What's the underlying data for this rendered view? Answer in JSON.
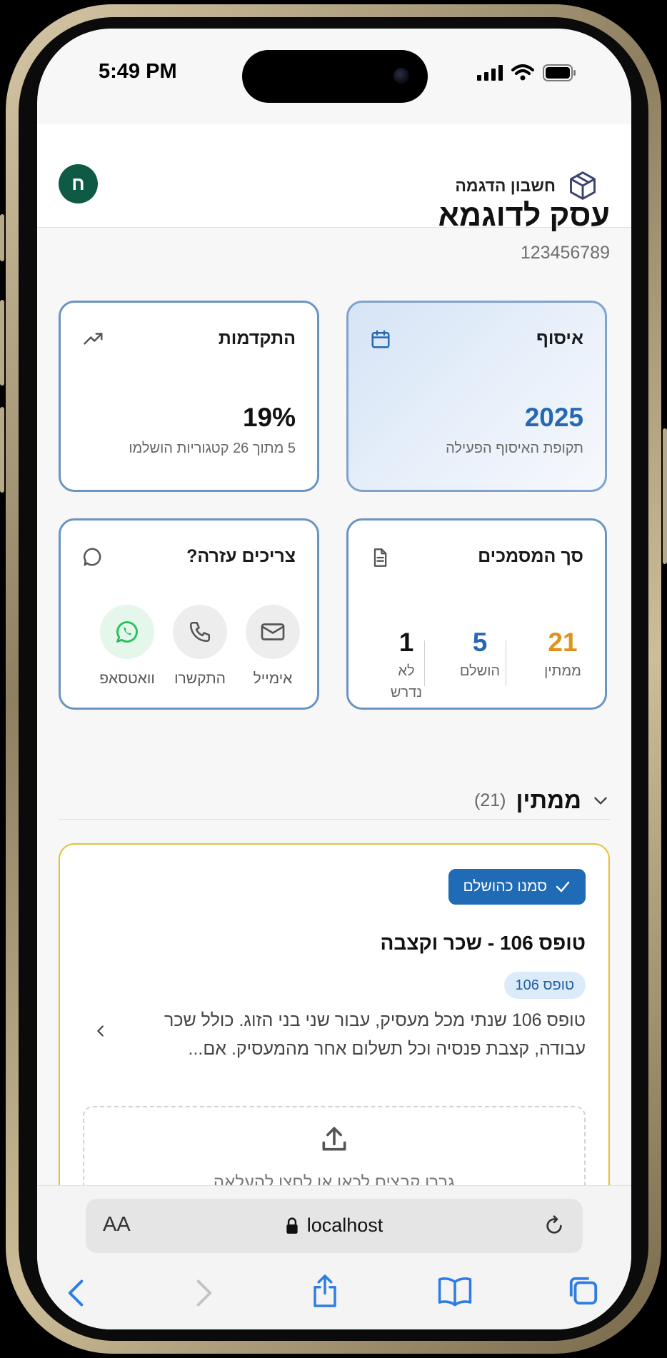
{
  "status": {
    "time": "5:49 PM"
  },
  "header": {
    "avatar_letter": "ח",
    "account_name": "חשבון הדגמה"
  },
  "business": {
    "name": "עסק לדוגמא",
    "id": "123456789"
  },
  "cards": {
    "collection": {
      "title": "איסוף",
      "value": "2025",
      "subtitle": "תקופת האיסוף הפעילה"
    },
    "progress": {
      "title": "התקדמות",
      "value": "19%",
      "subtitle": "5 מתוך 26 קטגוריות הושלמו"
    },
    "documents": {
      "title": "סך המסמכים",
      "stats": [
        {
          "value": "21",
          "label": "ממתין",
          "color": "#e0921c"
        },
        {
          "value": "5",
          "label": "הושלם",
          "color": "#2769b0"
        },
        {
          "value": "1",
          "label": "לא נדרש",
          "color": "#111111"
        }
      ]
    },
    "help": {
      "title": "צריכים עזרה?",
      "buttons": [
        {
          "label": "אימייל",
          "icon": "mail-icon"
        },
        {
          "label": "התקשרו",
          "icon": "phone-icon"
        },
        {
          "label": "וואטסאפ",
          "icon": "whatsapp-icon"
        }
      ]
    }
  },
  "section": {
    "title": "ממתין",
    "count": "(21)"
  },
  "task": {
    "mark_label": "סמנו כהושלם",
    "title": "טופס 106 - שכר וקצבה",
    "tag": "טופס 106",
    "description": "טופס 106 שנתי מכל מעסיק, עבור שני בני הזוג. כולל שכר עבודה, קצבת פנסיה וכל תשלום אחר מהמעסיק. אם...",
    "upload_text": "גררו קבצים לכאן או לחצו להעלאה"
  },
  "browser": {
    "aa": "AA",
    "url": "localhost"
  },
  "colors": {
    "accent": "#1f6bb6",
    "avatar": "#0f5a45",
    "pending": "#e0921c",
    "highlight": "#e4c03a"
  }
}
